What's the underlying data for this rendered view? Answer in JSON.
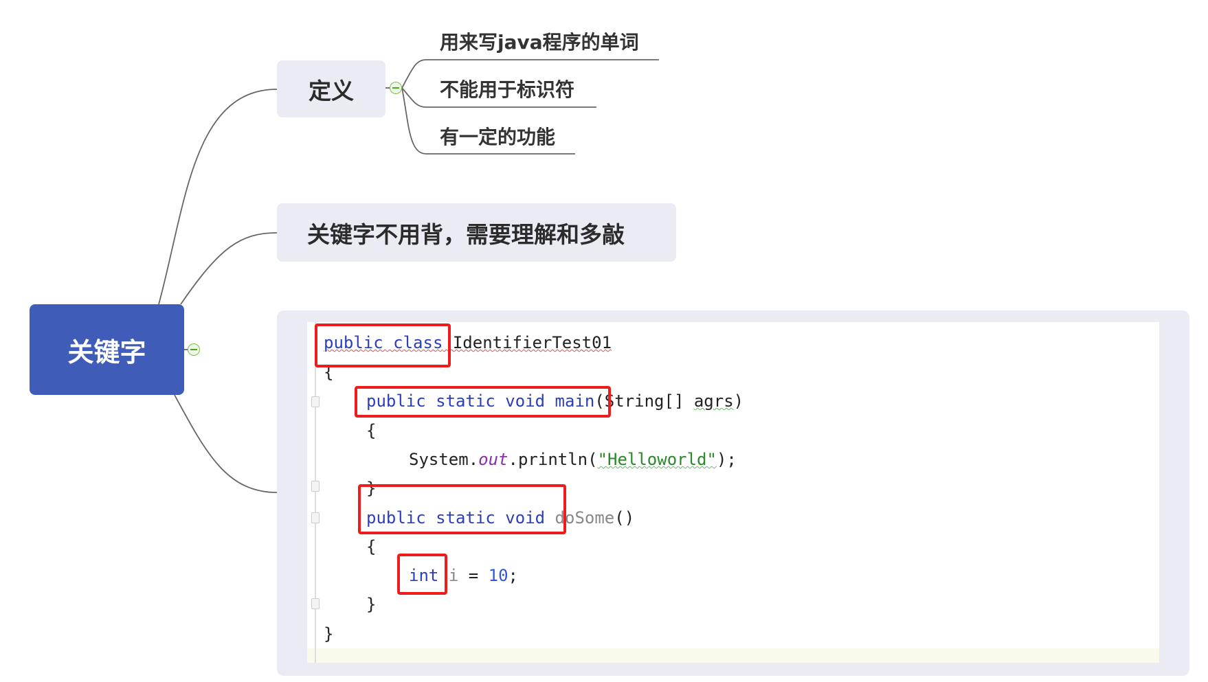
{
  "root": {
    "label": "关键字"
  },
  "definition": {
    "label": "定义",
    "children": [
      "用来写java程序的单词",
      "不能用于标识符",
      "有一定的功能"
    ]
  },
  "note": {
    "label": "关键字不用背，需要理解和多敲"
  },
  "code": {
    "class_kw": "public class",
    "class_name": "IdentifierTest01",
    "open_brace": "{",
    "close_brace": "}",
    "main_kw": "public static void",
    "main_name": "main",
    "main_params": "(String[] ",
    "main_arg": "agrs",
    "main_close": ")",
    "println_prefix": "System.",
    "println_out": "out",
    "println_call": ".println(",
    "println_string": "\"Helloworld\"",
    "println_end": ");",
    "dosome_kw": "public static void",
    "dosome_name": "doSome",
    "dosome_parens": "()",
    "int_kw": "int",
    "int_var": "i",
    "int_eq": " = ",
    "int_val": "10",
    "int_end": ";"
  },
  "colors": {
    "root": "#3f5db8",
    "topic": "#eaebf3",
    "highlight": "#ee1c1c",
    "keyword": "#2c3fbb"
  }
}
